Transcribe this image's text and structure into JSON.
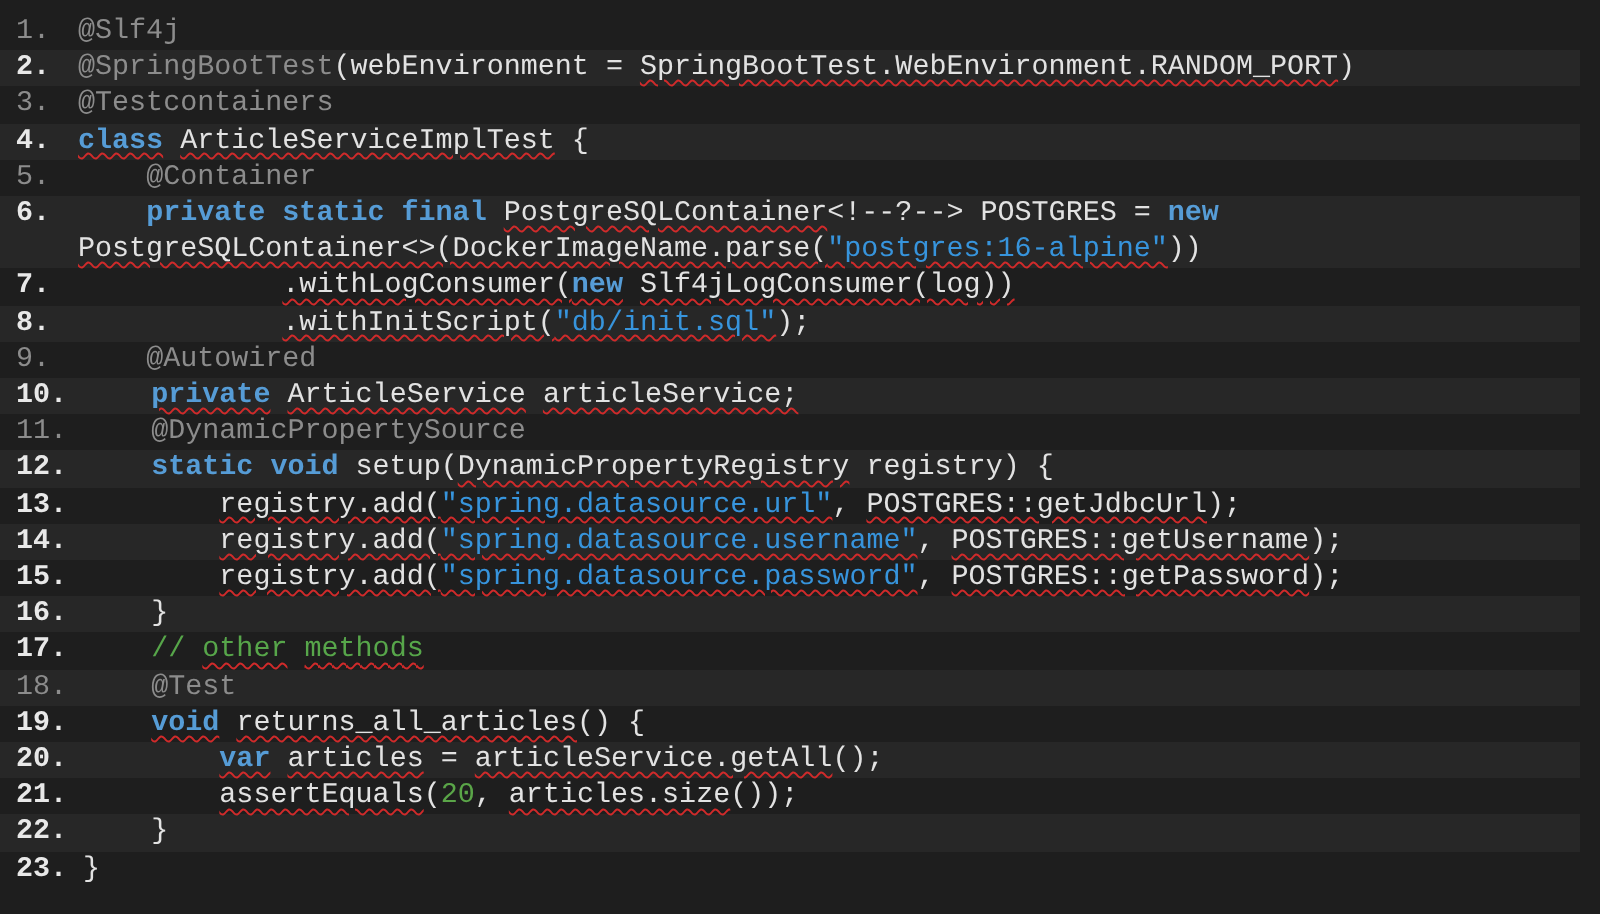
{
  "editor": {
    "lines": [
      {
        "number": "1.",
        "muted": true,
        "tokens": [
          {
            "kind": "annotation",
            "text": "@Slf4j",
            "squiggle": false
          }
        ]
      },
      {
        "number": "2.",
        "muted": false,
        "tokens": [
          {
            "kind": "annotation",
            "text": "@SpringBootTest",
            "squiggle": false
          },
          {
            "kind": "plain",
            "text": "(webEnvironment = ",
            "squiggle": false
          },
          {
            "kind": "plain",
            "text": "SpringBootTest.WebEnvironment.RANDOM_PORT",
            "squiggle": true
          },
          {
            "kind": "plain",
            "text": ")",
            "squiggle": false
          }
        ]
      },
      {
        "number": "3.",
        "muted": true,
        "tokens": [
          {
            "kind": "annotation",
            "text": "@Testcontainers",
            "squiggle": false
          }
        ]
      },
      {
        "number": "4.",
        "muted": false,
        "tokens": [
          {
            "kind": "keyword",
            "text": "class",
            "squiggle": true
          },
          {
            "kind": "plain",
            "text": " ArticleServiceImplTest",
            "squiggle": true
          },
          {
            "kind": "plain",
            "text": " {",
            "squiggle": false
          }
        ]
      },
      {
        "number": "5.",
        "muted": true,
        "tokens": [
          {
            "kind": "annotation",
            "text": "    @Container",
            "squiggle": false
          }
        ]
      },
      {
        "number": "6.",
        "muted": false,
        "tokens": [
          {
            "kind": "keyword",
            "text": "    private static final",
            "squiggle": false
          },
          {
            "kind": "plain",
            "text": " PostgreSQLContainer",
            "squiggle": true
          },
          {
            "kind": "plain",
            "text": "<!--?--> POSTGRES = ",
            "squiggle": false
          },
          {
            "kind": "keyword",
            "text": "new",
            "squiggle": false
          },
          {
            "kind": "plain",
            "text": " PostgreSQLContainer<>(DockerImageName.parse(",
            "squiggle": true
          },
          {
            "kind": "string",
            "text": "\"postgres:16-alpine\"",
            "squiggle": true
          },
          {
            "kind": "plain",
            "text": "))",
            "squiggle": false
          }
        ]
      },
      {
        "number": "7.",
        "muted": false,
        "tokens": [
          {
            "kind": "plain",
            "text": "            .withLogConsumer(",
            "squiggle": true
          },
          {
            "kind": "keyword",
            "text": "new",
            "squiggle": true
          },
          {
            "kind": "plain",
            "text": " Slf4jLogConsumer(log))",
            "squiggle": true
          }
        ]
      },
      {
        "number": "8.",
        "muted": false,
        "tokens": [
          {
            "kind": "plain",
            "text": "            .withInitScript(",
            "squiggle": true
          },
          {
            "kind": "string",
            "text": "\"db/init.sql\"",
            "squiggle": true
          },
          {
            "kind": "plain",
            "text": ");",
            "squiggle": false
          }
        ]
      },
      {
        "number": "9.",
        "muted": true,
        "tokens": [
          {
            "kind": "annotation",
            "text": "    @Autowired",
            "squiggle": false
          }
        ]
      },
      {
        "number": "10.",
        "muted": false,
        "tokens": [
          {
            "kind": "keyword",
            "text": "    private",
            "squiggle": true
          },
          {
            "kind": "plain",
            "text": " ArticleService",
            "squiggle": true
          },
          {
            "kind": "plain",
            "text": " articleService;",
            "squiggle": true
          }
        ]
      },
      {
        "number": "11.",
        "muted": true,
        "tokens": [
          {
            "kind": "annotation",
            "text": "    @DynamicPropertySource",
            "squiggle": false
          }
        ]
      },
      {
        "number": "12.",
        "muted": false,
        "tokens": [
          {
            "kind": "keyword",
            "text": "    static void",
            "squiggle": false
          },
          {
            "kind": "plain",
            "text": " setup(",
            "squiggle": false
          },
          {
            "kind": "plain",
            "text": "DynamicPropertyRegistry",
            "squiggle": true
          },
          {
            "kind": "plain",
            "text": " registry) {",
            "squiggle": false
          }
        ]
      },
      {
        "number": "13.",
        "muted": false,
        "tokens": [
          {
            "kind": "plain",
            "text": "        registry.add(",
            "squiggle": true
          },
          {
            "kind": "string",
            "text": "\"spring.datasource.url\"",
            "squiggle": true
          },
          {
            "kind": "plain",
            "text": ", ",
            "squiggle": false
          },
          {
            "kind": "plain",
            "text": "POSTGRES::getJdbcUrl",
            "squiggle": true
          },
          {
            "kind": "plain",
            "text": ");",
            "squiggle": false
          }
        ]
      },
      {
        "number": "14.",
        "muted": false,
        "tokens": [
          {
            "kind": "plain",
            "text": "        registry.add(",
            "squiggle": true
          },
          {
            "kind": "string",
            "text": "\"spring.datasource.username\"",
            "squiggle": true
          },
          {
            "kind": "plain",
            "text": ", ",
            "squiggle": false
          },
          {
            "kind": "plain",
            "text": "POSTGRES::getUsername",
            "squiggle": true
          },
          {
            "kind": "plain",
            "text": ");",
            "squiggle": false
          }
        ]
      },
      {
        "number": "15.",
        "muted": false,
        "tokens": [
          {
            "kind": "plain",
            "text": "        registry.add(",
            "squiggle": true
          },
          {
            "kind": "string",
            "text": "\"spring.datasource.password\"",
            "squiggle": true
          },
          {
            "kind": "plain",
            "text": ", ",
            "squiggle": false
          },
          {
            "kind": "plain",
            "text": "POSTGRES::getPassword",
            "squiggle": true
          },
          {
            "kind": "plain",
            "text": ");",
            "squiggle": false
          }
        ]
      },
      {
        "number": "16.",
        "muted": false,
        "tokens": [
          {
            "kind": "plain",
            "text": "    }",
            "squiggle": false
          }
        ]
      },
      {
        "number": "17.",
        "muted": false,
        "tokens": [
          {
            "kind": "comment",
            "text": "    // ",
            "squiggle": false
          },
          {
            "kind": "comment",
            "text": "other",
            "squiggle": true
          },
          {
            "kind": "comment",
            "text": " methods",
            "squiggle": true
          }
        ]
      },
      {
        "number": "18.",
        "muted": true,
        "tokens": [
          {
            "kind": "annotation",
            "text": "    @Test",
            "squiggle": false
          }
        ]
      },
      {
        "number": "19.",
        "muted": false,
        "tokens": [
          {
            "kind": "keyword",
            "text": "    void",
            "squiggle": true
          },
          {
            "kind": "plain",
            "text": " returns_all_articles",
            "squiggle": true
          },
          {
            "kind": "plain",
            "text": "() {",
            "squiggle": false
          }
        ]
      },
      {
        "number": "20.",
        "muted": false,
        "tokens": [
          {
            "kind": "keyword",
            "text": "        var",
            "squiggle": true
          },
          {
            "kind": "plain",
            "text": " articles",
            "squiggle": true
          },
          {
            "kind": "plain",
            "text": " = ",
            "squiggle": false
          },
          {
            "kind": "plain",
            "text": "articleService.getAll",
            "squiggle": true
          },
          {
            "kind": "plain",
            "text": "();",
            "squiggle": false
          }
        ]
      },
      {
        "number": "21.",
        "muted": false,
        "tokens": [
          {
            "kind": "plain",
            "text": "        assertEquals",
            "squiggle": true
          },
          {
            "kind": "plain",
            "text": "(",
            "squiggle": false
          },
          {
            "kind": "number",
            "text": "20",
            "squiggle": false
          },
          {
            "kind": "plain",
            "text": ", ",
            "squiggle": false
          },
          {
            "kind": "plain",
            "text": "articles.size",
            "squiggle": true
          },
          {
            "kind": "plain",
            "text": "());",
            "squiggle": false
          }
        ]
      },
      {
        "number": "22.",
        "muted": false,
        "tokens": [
          {
            "kind": "plain",
            "text": "    }",
            "squiggle": false
          }
        ]
      },
      {
        "number": "23.",
        "muted": false,
        "tokens": [
          {
            "kind": "plain",
            "text": "}",
            "squiggle": false
          }
        ]
      }
    ]
  }
}
